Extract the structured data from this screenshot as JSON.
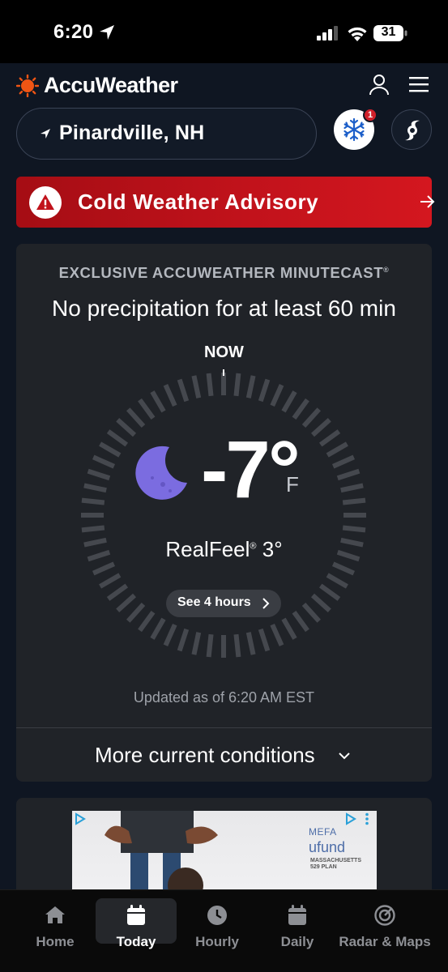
{
  "status_bar": {
    "time": "6:20",
    "battery": "31"
  },
  "header": {
    "logo": "AccuWeather",
    "icons": [
      "sun-logo-icon",
      "user-icon",
      "menu-icon"
    ]
  },
  "location": {
    "name": "Pinardville, NH"
  },
  "quick_buttons": {
    "winter_badge": "1",
    "icons": [
      "snowflake-icon",
      "hurricane-icon"
    ]
  },
  "advisory": {
    "text": "Cold Weather Advisory",
    "color": "#c1121b"
  },
  "minutecast": {
    "title": "EXCLUSIVE ACCUWEATHER MINUTECAST",
    "title_mark": "®",
    "summary": "No precipitation for at least 60 min",
    "now_label": "NOW",
    "temperature": "-7°",
    "unit": "F",
    "realfeel_label": "RealFeel",
    "realfeel_mark": "®",
    "realfeel_value": "3°",
    "see_hours": "See 4 hours",
    "updated": "Updated as of 6:20 AM EST",
    "more_conditions": "More current conditions"
  },
  "ad": {
    "brand": "MEFA",
    "product": "ufund",
    "tagline_1": "MASSACHUSETTS",
    "tagline_2": "529 PLAN"
  },
  "bottom_nav": {
    "items": [
      {
        "label": "Home",
        "icon": "home-icon"
      },
      {
        "label": "Today",
        "icon": "calendar-day-icon"
      },
      {
        "label": "Hourly",
        "icon": "clock-icon"
      },
      {
        "label": "Daily",
        "icon": "calendar-icon"
      },
      {
        "label": "Radar & Maps",
        "icon": "radar-icon"
      }
    ],
    "active": "Today"
  }
}
